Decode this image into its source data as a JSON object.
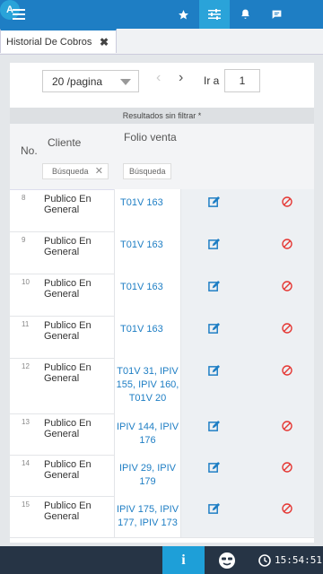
{
  "topbar": {
    "avatar_letter": "A"
  },
  "tab": {
    "title": "Historial De Cobros",
    "close_glyph": "✖"
  },
  "pager": {
    "page_size": "20 /pagina",
    "prev": "‹",
    "next": "›",
    "goto_label": "Ir a",
    "goto_value": "1"
  },
  "filter_status": "Resultados sin filtrar *",
  "table": {
    "headers": {
      "no": "No.",
      "cliente": "Cliente",
      "folio": "Folio venta"
    },
    "search_cliente": "Búsqueda",
    "search_cliente_clear": "✕",
    "search_folio": "Búsqueda",
    "rows": [
      {
        "no": "8",
        "cliente": "Publico En General",
        "folio": "T01V 163"
      },
      {
        "no": "9",
        "cliente": "Publico En General",
        "folio": "T01V 163"
      },
      {
        "no": "10",
        "cliente": "Publico En General",
        "folio": "T01V 163"
      },
      {
        "no": "11",
        "cliente": "Publico En General",
        "folio": "T01V 163"
      },
      {
        "no": "12",
        "cliente": "Publico En General",
        "folio": "T01V 31, IPIV\n155, IPIV 160,\nT01V 20"
      },
      {
        "no": "13",
        "cliente": "Publico En General",
        "folio": "IPIV 144, IPIV\n176"
      },
      {
        "no": "14",
        "cliente": "Publico En General",
        "folio": "IPIV 29, IPIV\n179"
      },
      {
        "no": "15",
        "cliente": "Publico En General",
        "folio": "IPIV 175, IPIV\n177, IPIV 173"
      }
    ]
  },
  "bottombar": {
    "info_glyph": "i",
    "time": "15:54:51"
  },
  "colors": {
    "primary": "#1e7ec4",
    "accent": "#2aa3d9",
    "cancel": "#e53935",
    "bottombar": "#263445"
  }
}
